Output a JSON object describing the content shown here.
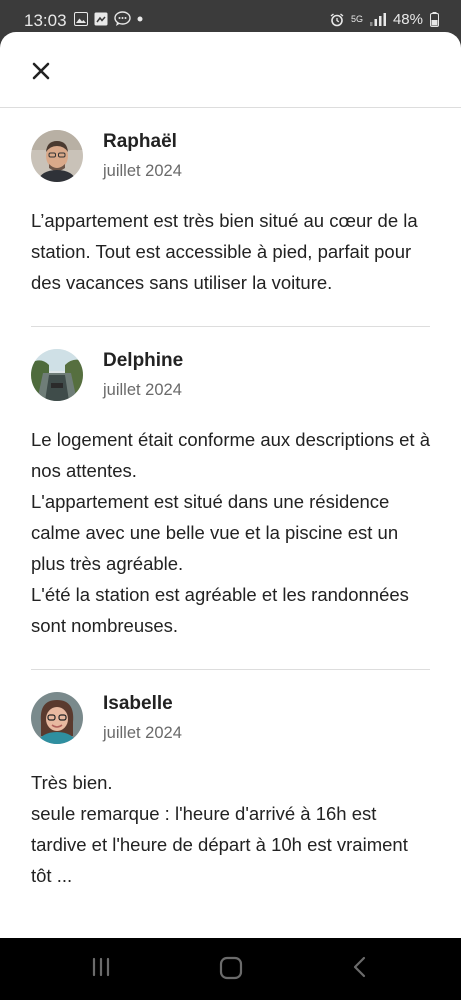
{
  "status_bar": {
    "time": "13:03",
    "network": "5G",
    "battery": "48%"
  },
  "reviews": [
    {
      "name": "Raphaël",
      "date": "juillet 2024",
      "text": "L’appartement est très bien situé au cœur de la station. Tout est accessible à pied, parfait pour des vacances sans utiliser la voiture."
    },
    {
      "name": "Delphine",
      "date": "juillet 2024",
      "text": "Le logement était conforme aux descriptions et à nos attentes.\nL'appartement est situé dans une résidence calme avec une belle vue et la piscine est un plus très agréable.\nL'été la station est agréable et les randonnées sont nombreuses."
    },
    {
      "name": "Isabelle",
      "date": "juillet 2024",
      "text": "Très bien.\nseule remarque : l'heure d'arrivé à 16h est tardive et l'heure de départ à 10h est vraiment tôt ..."
    }
  ],
  "icons": {
    "close": "close-icon",
    "nav_recents": "recents-icon",
    "nav_home": "home-icon",
    "nav_back": "back-icon"
  },
  "colors": {
    "text": "#222222",
    "muted": "#6a6a6a",
    "divider": "#dddddd"
  }
}
